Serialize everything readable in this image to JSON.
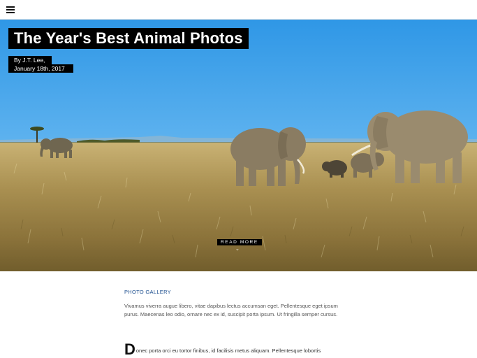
{
  "nav": {
    "menu_icon": "hamburger-menu-icon"
  },
  "hero": {
    "title": "The Year's Best Animal Photos",
    "author": "By J.T. Lee,",
    "date": "January 18th, 2017",
    "read_more": "READ MORE",
    "scroll_icon": "chevron-down-icon",
    "image_subject": "elephants"
  },
  "article": {
    "category": "PHOTO GALLERY",
    "intro": "Vivamus viverra augue libero, vitae dapibus lectus accumsan eget. Pellentesque eget ipsum purus. Maecenas leo odio, ornare nec ex id, suscipit porta ipsum. Ut fringilla semper cursus.",
    "drop_cap": "D",
    "body_start": "onec porta orci eu tortor finibus, id facilisis metus aliquam. Pellentesque lobortis"
  }
}
